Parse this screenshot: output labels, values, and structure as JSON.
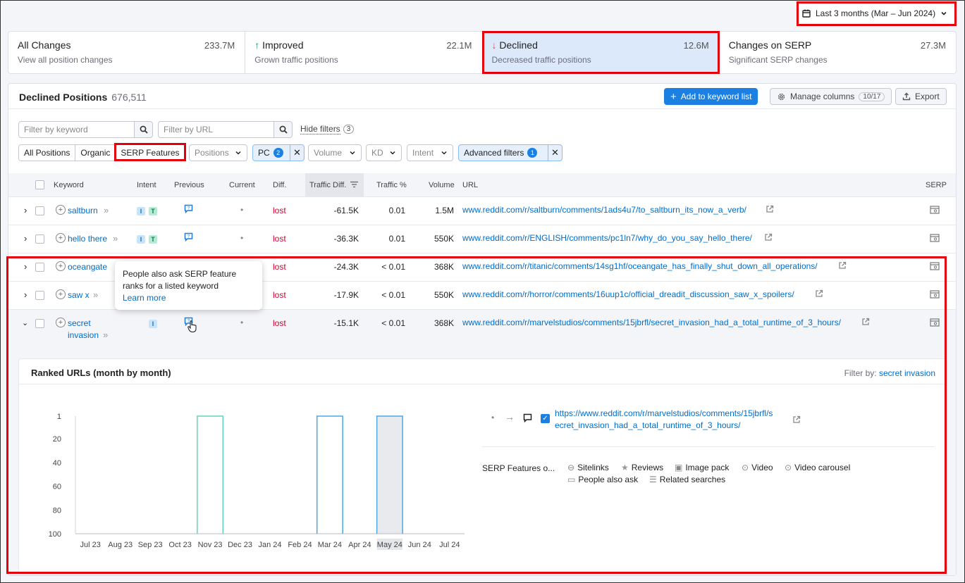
{
  "date_range": {
    "label": "Last 3 months (Mar – Jun 2024)"
  },
  "tabs": [
    {
      "title": "All Changes",
      "value": "233.7M",
      "subtitle": "View all position changes",
      "arrow": ""
    },
    {
      "title": "Improved",
      "value": "22.1M",
      "subtitle": "Grown traffic positions",
      "arrow": "↑"
    },
    {
      "title": "Declined",
      "value": "12.6M",
      "subtitle": "Decreased traffic positions",
      "arrow": "↓"
    },
    {
      "title": "Changes on SERP",
      "value": "27.3M",
      "subtitle": "Significant SERP changes",
      "arrow": ""
    }
  ],
  "panel": {
    "title": "Declined Positions",
    "count": "676,511",
    "add_btn": "Add to keyword list",
    "manage_btn": "Manage columns",
    "manage_badge": "10/17",
    "export_btn": "Export"
  },
  "filters": {
    "keyword_placeholder": "Filter by keyword",
    "url_placeholder": "Filter by URL",
    "hide_filters": "Hide filters",
    "hide_count": "3",
    "seg": [
      "All Positions",
      "Organic",
      "SERP Features"
    ],
    "positions": "Positions",
    "pc": "PC",
    "pc_badge": "2",
    "volume": "Volume",
    "kd": "KD",
    "intent": "Intent",
    "advanced": "Advanced filters",
    "advanced_badge": "1"
  },
  "table": {
    "headers": {
      "keyword": "Keyword",
      "intent": "Intent",
      "previous": "Previous",
      "current": "Current",
      "diff": "Diff.",
      "traffic_diff": "Traffic Diff.",
      "traffic_pct": "Traffic %",
      "volume": "Volume",
      "url": "URL",
      "serp": "SERP"
    },
    "rows": [
      {
        "keyword": "saltburn",
        "keyword2": "",
        "diff": "lost",
        "traffic_diff": "-61.5K",
        "traffic_pct": "0.01",
        "volume": "1.5M",
        "url": "www.reddit.com/r/saltburn/comments/1ads4u7/to_saltburn_its_now_a_verb/"
      },
      {
        "keyword": "hello there",
        "keyword2": "",
        "diff": "lost",
        "traffic_diff": "-36.3K",
        "traffic_pct": "0.01",
        "volume": "550K",
        "url": "www.reddit.com/r/ENGLISH/comments/pc1ln7/why_do_you_say_hello_there/"
      },
      {
        "keyword": "oceangate",
        "keyword2": "",
        "diff": "lost",
        "traffic_diff": "-24.3K",
        "traffic_pct": "< 0.01",
        "volume": "368K",
        "url": "www.reddit.com/r/titanic/comments/14sg1hf/oceangate_has_finally_shut_down_all_operations/"
      },
      {
        "keyword": "saw x",
        "keyword2": "",
        "diff": "lost",
        "traffic_diff": "-17.9K",
        "traffic_pct": "< 0.01",
        "volume": "550K",
        "url": "www.reddit.com/r/horror/comments/16uup1c/official_dreadit_discussion_saw_x_spoilers/"
      },
      {
        "keyword": "secret",
        "keyword2": "invasion",
        "diff": "lost",
        "traffic_diff": "-15.1K",
        "traffic_pct": "< 0.01",
        "volume": "368K",
        "url": "www.reddit.com/r/marvelstudios/comments/15jbrfl/secret_invasion_had_a_total_runtime_of_3_hours/"
      }
    ],
    "current_placeholder": "•"
  },
  "tooltip": {
    "line1": "People also ask SERP feature",
    "line2": "ranks for a listed keyword",
    "link": "Learn more"
  },
  "ranked": {
    "title": "Ranked URLs (month by month)",
    "filter_label": "Filter by:",
    "filter_value": "secret invasion",
    "url_line1": "https://www.reddit.com/r/marvelstudios/comments/15jbrfl/s",
    "url_line2": "ecret_invasion_had_a_total_runtime_of_3_hours/",
    "legend_dot": "•",
    "features_label": "SERP Features o...",
    "features": [
      "Sitelinks",
      "Reviews",
      "Image pack",
      "Video",
      "Video carousel",
      "People also ask",
      "Related searches"
    ]
  },
  "chart_data": {
    "type": "bar",
    "categories": [
      "Jul 23",
      "Aug 23",
      "Sep 23",
      "Oct 23",
      "Nov 23",
      "Dec 23",
      "Jan 24",
      "Feb 24",
      "Mar 24",
      "Apr 24",
      "May 24",
      "Jun 24",
      "Jul 24"
    ],
    "values": [
      null,
      null,
      null,
      null,
      1,
      null,
      null,
      null,
      1,
      null,
      1,
      null,
      null
    ],
    "y_ticks": [
      "1",
      "20",
      "40",
      "60",
      "80",
      "100"
    ],
    "ylim": [
      1,
      100
    ],
    "y_inverted": true,
    "highlight_category": "May 24",
    "colors": {
      "nov": "#5fd6b7",
      "mar": "#4aa8e8",
      "may": "#4aa8e8"
    }
  }
}
